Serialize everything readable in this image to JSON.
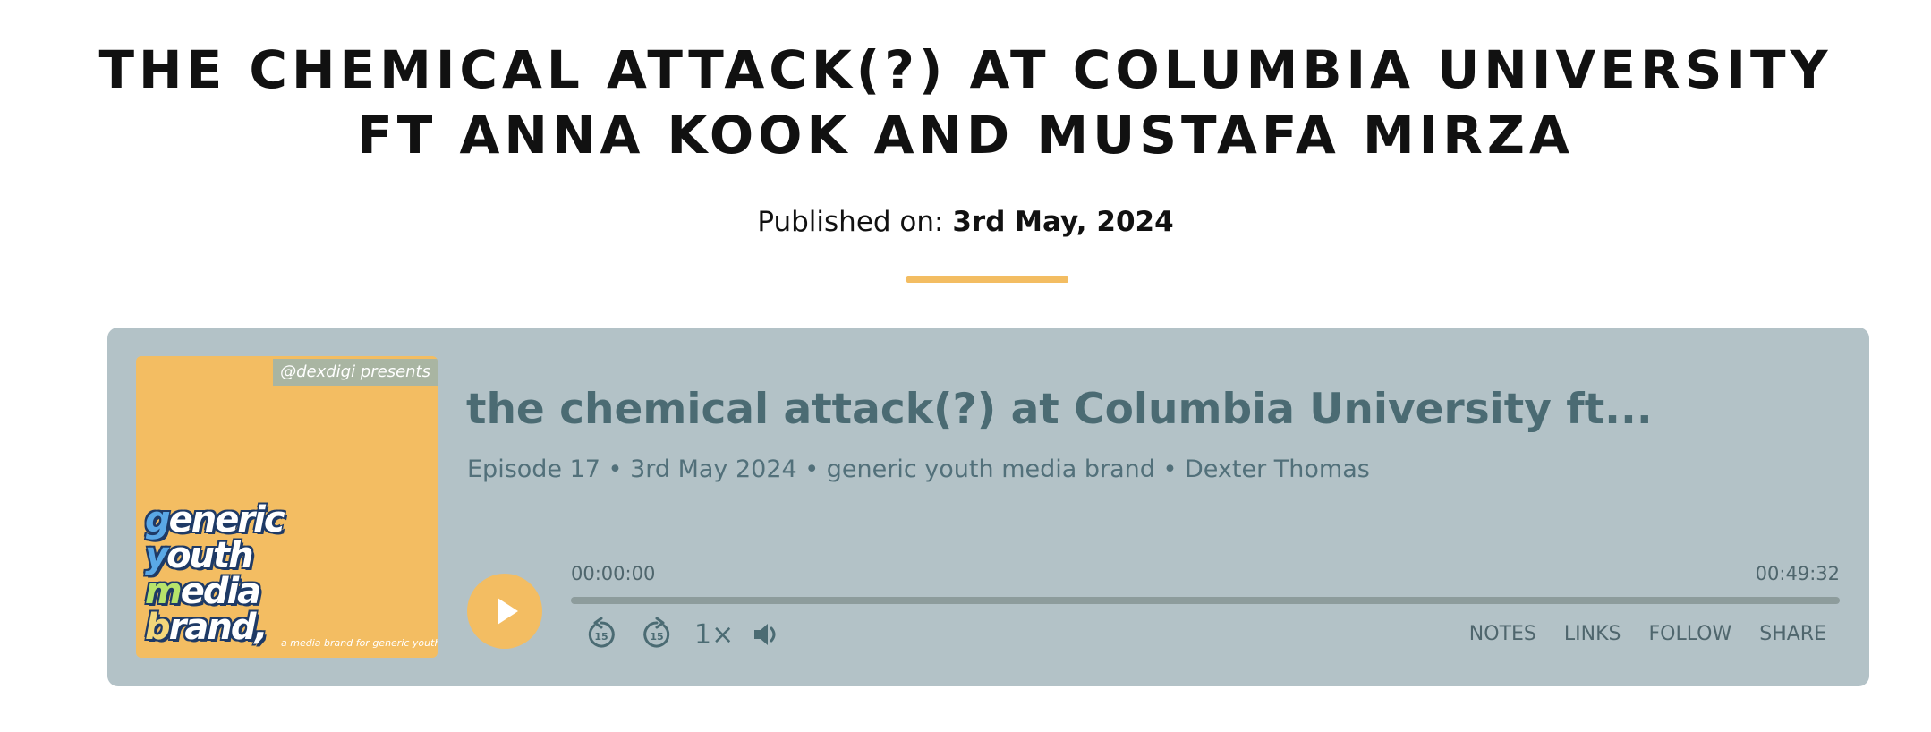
{
  "page": {
    "title": "THE CHEMICAL ATTACK(?) AT COLUMBIA UNIVERSITY FT ANNA KOOK AND MUSTAFA MIRZA",
    "published_label": "Published on: ",
    "published_date": "3rd May, 2024"
  },
  "player": {
    "cover": {
      "tag": "@dexdigi presents",
      "brand_lines": [
        "generic",
        "youth",
        "media",
        "brand,"
      ],
      "subtitle": "a media brand for generic youth"
    },
    "episode_title": "the chemical attack(?) at Columbia University ft...",
    "episode_meta": "Episode 17 • 3rd May 2024 • generic youth media brand • Dexter Thomas",
    "time_current": "00:00:00",
    "time_total": "00:49:32",
    "progress": 0,
    "speed": "1×",
    "rewind_seconds": "15",
    "forward_seconds": "15",
    "links": [
      "NOTES",
      "LINKS",
      "FOLLOW",
      "SHARE"
    ],
    "colors": {
      "accent": "#f3bd62",
      "player_bg": "#b3c2c7",
      "text": "#4b6b73"
    },
    "icons": {
      "play": "play-icon",
      "rewind": "rewind-15-icon",
      "forward": "forward-15-icon",
      "volume": "volume-icon"
    }
  }
}
